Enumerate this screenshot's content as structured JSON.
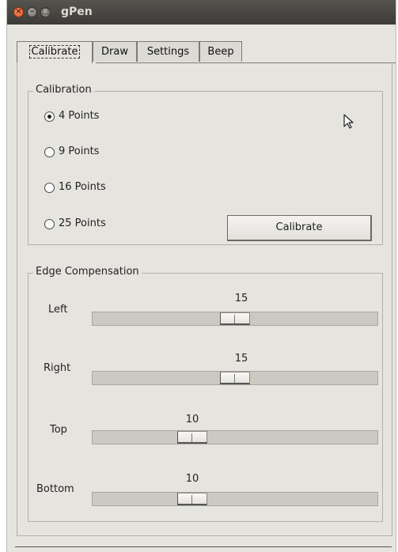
{
  "window": {
    "title": "gPen",
    "controls": {
      "close": "×",
      "minimize": "–",
      "maximize": "□"
    }
  },
  "tabs": [
    {
      "label": "Calibrate",
      "active": true
    },
    {
      "label": "Draw",
      "active": false
    },
    {
      "label": "Settings",
      "active": false
    },
    {
      "label": "Beep",
      "active": false
    }
  ],
  "calibration": {
    "title": "Calibration",
    "options": [
      {
        "label": "4 Points",
        "selected": true
      },
      {
        "label": "9 Points",
        "selected": false
      },
      {
        "label": "16 Points",
        "selected": false
      },
      {
        "label": "25 Points",
        "selected": false
      }
    ],
    "button_label": "Calibrate"
  },
  "edge_compensation": {
    "title": "Edge Compensation",
    "sliders": [
      {
        "label": "Left",
        "value": "15"
      },
      {
        "label": "Right",
        "value": "15"
      },
      {
        "label": "Top",
        "value": "10"
      },
      {
        "label": "Bottom",
        "value": "10"
      }
    ]
  },
  "colors": {
    "window_bg": "#e6e4df",
    "titlebar": "#3c3b37",
    "close_button": "#e0541b"
  },
  "icons": [
    "close-icon",
    "minimize-icon",
    "maximize-icon",
    "mouse-pointer-icon"
  ]
}
